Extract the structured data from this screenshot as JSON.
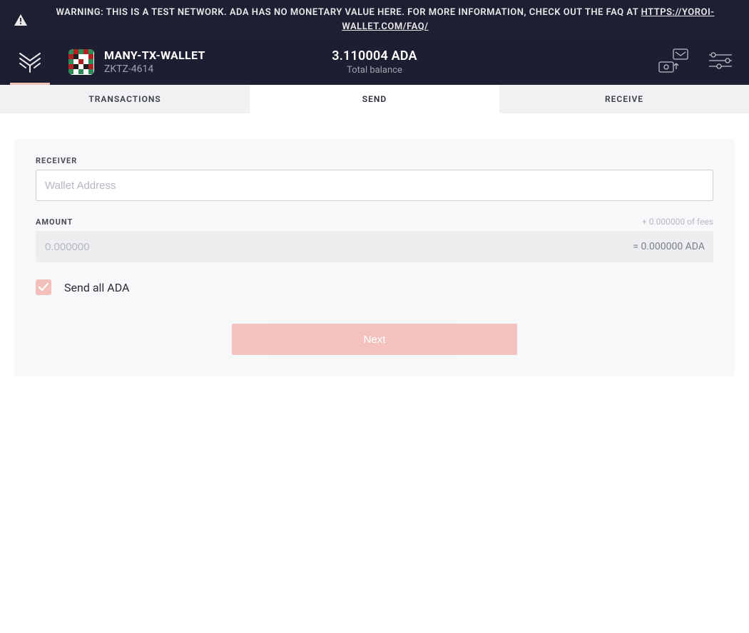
{
  "banner": {
    "warning_text": "WARNING: THIS IS A TEST NETWORK. ADA HAS NO MONETARY VALUE HERE. FOR MORE INFORMATION, CHECK OUT THE FAQ AT ",
    "faq_link_text": "HTTPS://YOROI-WALLET.COM/FAQ/",
    "icon": "warning-triangle"
  },
  "header": {
    "logo_icon": "yoroi-logo",
    "wallet": {
      "name": "MANY-TX-WALLET",
      "id": "ZKTZ-4614",
      "avatar_colors": [
        "#2e8b57",
        "#b22222",
        "#1e1e1e",
        "#ffffff"
      ]
    },
    "balance": {
      "amount": "3.110004 ADA",
      "label": "Total balance"
    },
    "right_icons": [
      "wallet-stack-icon",
      "settings-sliders-icon"
    ]
  },
  "tabs": [
    {
      "label": "TRANSACTIONS",
      "active": false
    },
    {
      "label": "SEND",
      "active": true
    },
    {
      "label": "RECEIVE",
      "active": false
    }
  ],
  "send_form": {
    "receiver_label": "RECEIVER",
    "receiver_placeholder": "Wallet Address",
    "receiver_value": "",
    "amount_label": "AMOUNT",
    "fees_hint": "+ 0.000000 of fees",
    "amount_placeholder": "0.000000",
    "amount_value": "",
    "amount_display_suffix": "= 0.000000 ADA",
    "send_all_checked": true,
    "send_all_label": "Send all ADA",
    "next_button_label": "Next",
    "next_enabled": false
  }
}
